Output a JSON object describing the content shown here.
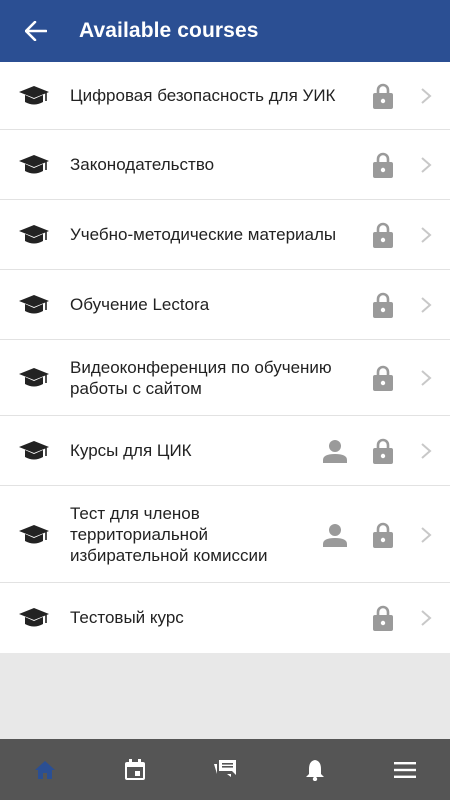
{
  "header": {
    "title": "Available courses",
    "back_icon": "arrow-back-icon"
  },
  "courses": [
    {
      "title": "Цифровая безопасность для УИК",
      "locked": true,
      "user": false
    },
    {
      "title": "Законодательство",
      "locked": true,
      "user": false
    },
    {
      "title": "Учебно-методические материалы",
      "locked": true,
      "user": false
    },
    {
      "title": "Обучение Lectora",
      "locked": true,
      "user": false
    },
    {
      "title": "Видеоконференция по обучению работы с сайтом",
      "locked": true,
      "user": false
    },
    {
      "title": "Курсы для ЦИК",
      "locked": true,
      "user": true
    },
    {
      "title": "Тест для членов территориальной избирательной комиссии",
      "locked": true,
      "user": true
    },
    {
      "title": "Тестовый курс",
      "locked": true,
      "user": false
    }
  ],
  "bottom_nav": [
    {
      "icon": "home-icon",
      "active": true
    },
    {
      "icon": "calendar-icon",
      "active": false
    },
    {
      "icon": "chat-icon",
      "active": false
    },
    {
      "icon": "bell-icon",
      "active": false
    },
    {
      "icon": "menu-icon",
      "active": false
    }
  ],
  "colors": {
    "appbar": "#2b4f93",
    "nav_active": "#2b4f93",
    "nav_inactive": "#ffffff",
    "icon_gray": "#9a9a9a"
  }
}
